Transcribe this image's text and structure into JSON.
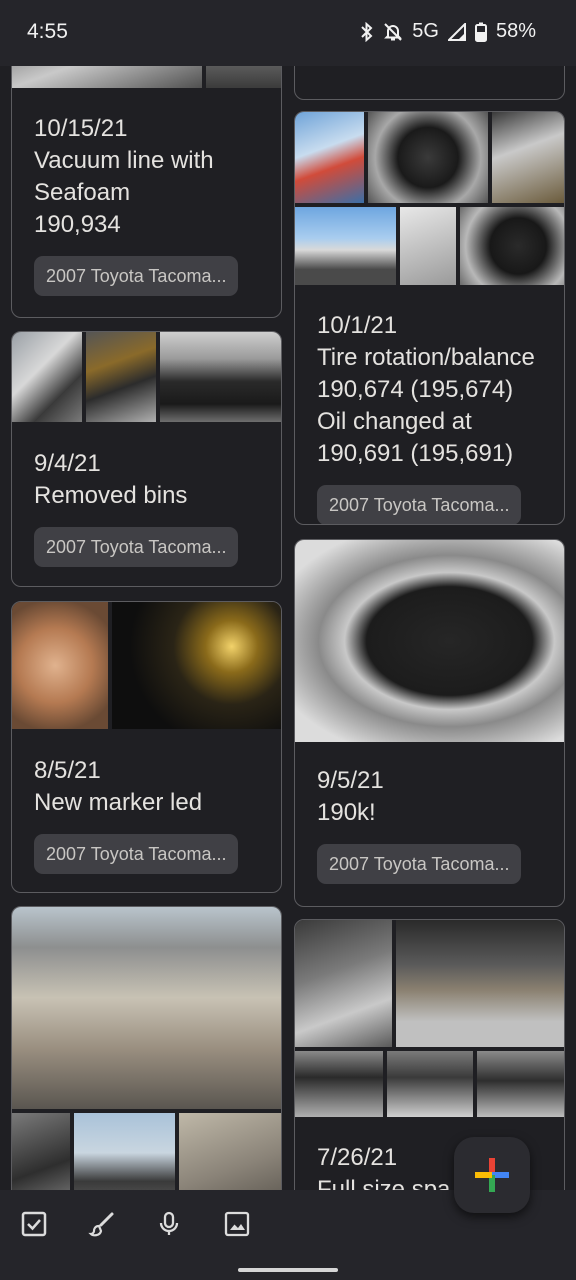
{
  "status": {
    "time": "4:55",
    "network": "5G",
    "battery": "58%",
    "icons": [
      "bluetooth-icon",
      "bell-off-icon",
      "signal-icon",
      "battery-icon"
    ]
  },
  "notes": [
    {
      "date": "10/15/21",
      "lines": [
        "Vacuum line with",
        "Seafoam",
        "190,934"
      ],
      "label": "2007 Toyota Tacoma..."
    },
    {
      "date": "9/4/21",
      "lines": [
        "Removed bins"
      ],
      "label": "2007 Toyota Tacoma..."
    },
    {
      "date": "8/5/21",
      "lines": [
        "New marker led"
      ],
      "label": "2007 Toyota Tacoma..."
    },
    {
      "date": "10/1/21",
      "lines": [
        "Tire rotation/balance",
        "190,674 (195,674)",
        "Oil changed at",
        "190,691 (195,691)"
      ],
      "label": "2007 Toyota Tacoma..."
    },
    {
      "date": "9/5/21",
      "lines": [
        "190k!"
      ],
      "label": "2007 Toyota Tacoma..."
    },
    {
      "date": "7/26/21",
      "lines": [
        "Full size spa"
      ],
      "label": ""
    }
  ],
  "bottom_bar": {
    "tools": [
      "checkbox-icon",
      "brush-icon",
      "mic-icon",
      "image-icon"
    ]
  },
  "fab": {
    "icon": "plus-icon"
  },
  "colors": {
    "background": "#1f1f23",
    "bar": "#25252a",
    "chip": "#404045",
    "border": "#5c5c60"
  }
}
